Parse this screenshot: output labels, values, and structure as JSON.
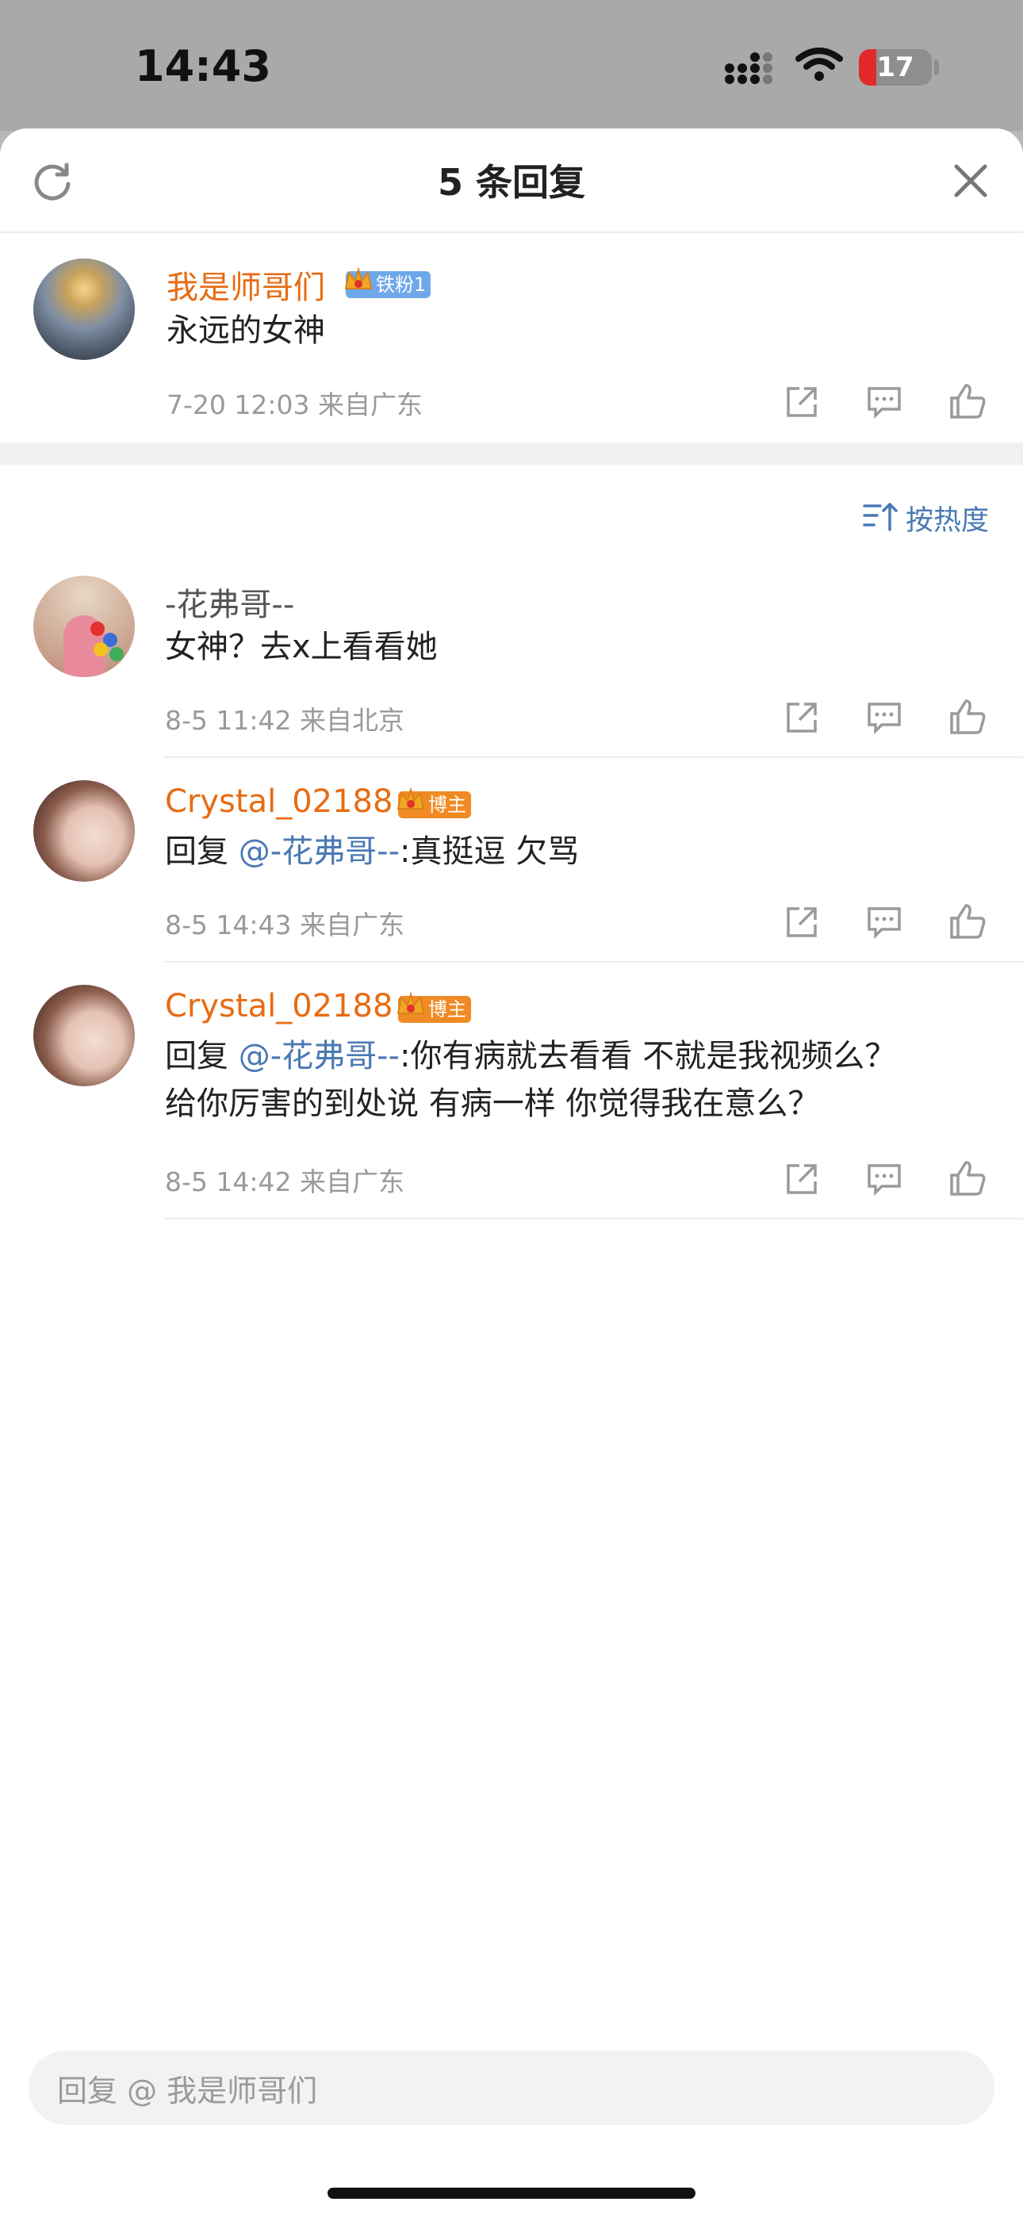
{
  "status_bar": {
    "time": "14:43",
    "battery": "17"
  },
  "header": {
    "title": "5 条回复"
  },
  "root_comment": {
    "username": "我是师哥们",
    "badge": "铁粉1",
    "content": "永远的女神",
    "meta": "7-20 12:03  来自广东"
  },
  "sort": {
    "label": "按热度"
  },
  "replies": [
    {
      "username": "-花弗哥--",
      "content": "女神？去x上看看她",
      "meta": "8-5 11:42  来自北京"
    },
    {
      "username": "Crystal_02188",
      "badge": "博主",
      "reply_prefix": "回复 ",
      "mention": "@-花弗哥--",
      "content": ":真挺逗 欠骂",
      "meta": "8-5 14:43  来自广东"
    },
    {
      "username": "Crystal_02188",
      "badge": "博主",
      "reply_prefix": "回复 ",
      "mention": "@-花弗哥--",
      "content_line1": ":你有病就去看看 不就是我视频么？",
      "content_line2": "给你厉害的到处说 有病一样 你觉得我在意么？",
      "meta": "8-5 14:42  来自广东"
    }
  ],
  "reply_input": {
    "placeholder": "回复 @ 我是师哥们"
  }
}
